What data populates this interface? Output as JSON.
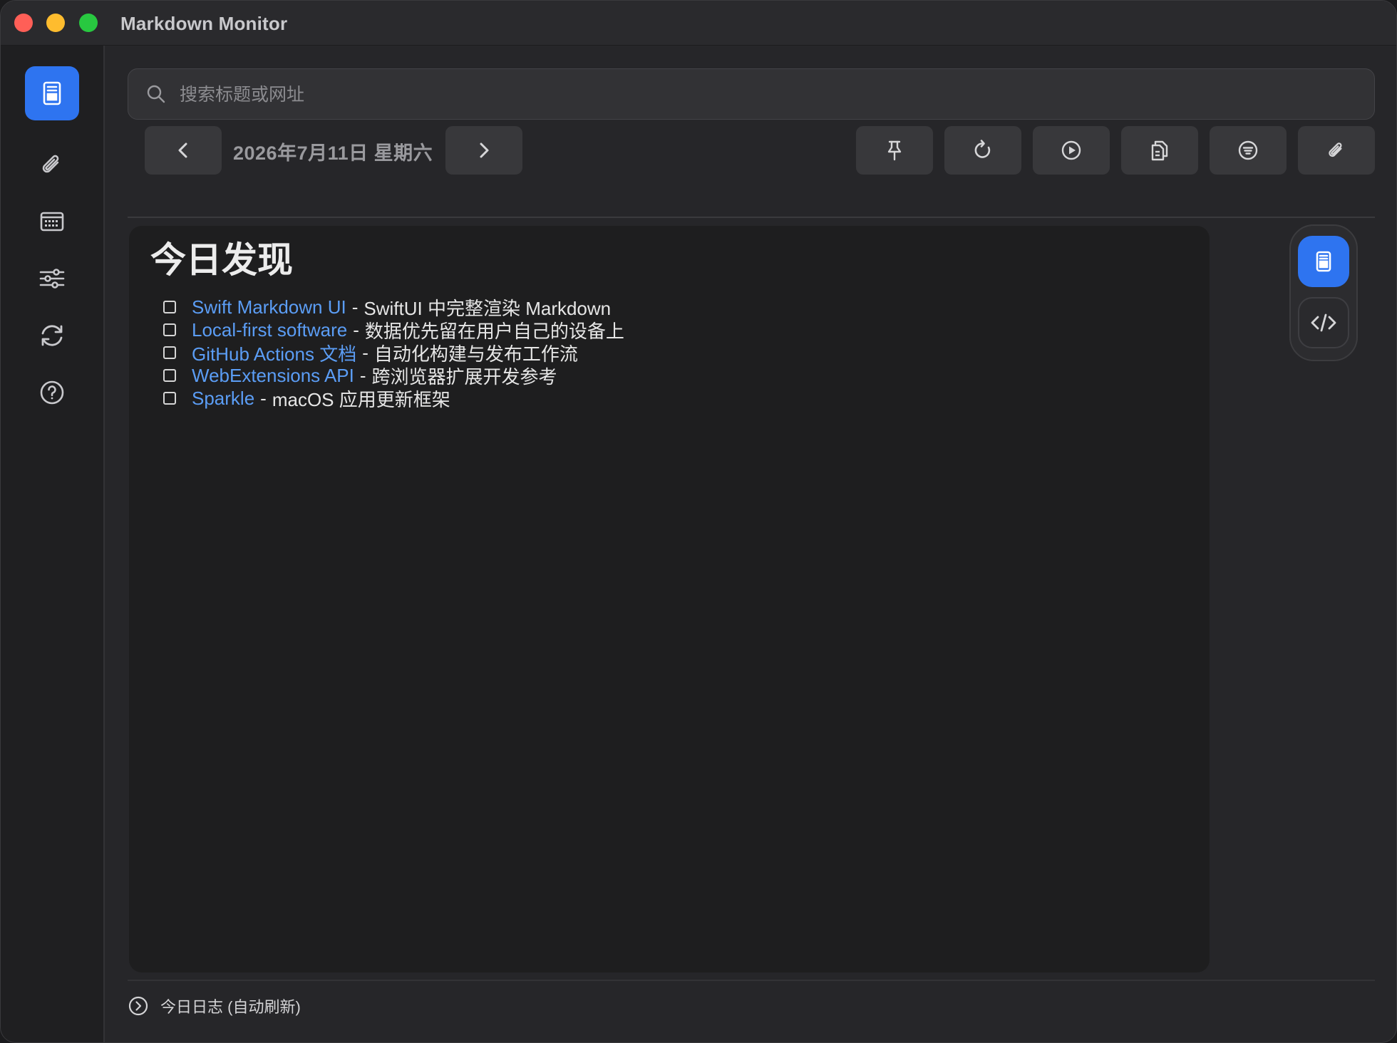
{
  "window": {
    "title": "Markdown Monitor"
  },
  "sidebar": {
    "items": [
      {
        "name": "document",
        "icon": "document-icon",
        "active": true
      },
      {
        "name": "attachments",
        "icon": "paperclip-icon",
        "active": false
      },
      {
        "name": "calendar",
        "icon": "calendar-icon",
        "active": false
      },
      {
        "name": "settings",
        "icon": "sliders-icon",
        "active": false
      },
      {
        "name": "sync",
        "icon": "sync-icon",
        "active": false
      },
      {
        "name": "help",
        "icon": "help-icon",
        "active": false
      }
    ]
  },
  "search": {
    "placeholder": "搜索标题或网址",
    "value": ""
  },
  "date_nav": {
    "date_label": "2026年7月11日 星期六"
  },
  "toolbar": [
    "pin-icon",
    "refresh-icon",
    "play-icon",
    "copy-icon",
    "filter-icon",
    "paperclip-icon"
  ],
  "content": {
    "heading": "今日发现",
    "items": [
      {
        "link": "Swift Markdown UI",
        "desc": "SwiftUI 中完整渲染 Markdown"
      },
      {
        "link": "Local-first software",
        "desc": "数据优先留在用户自己的设备上"
      },
      {
        "link": "GitHub Actions 文档",
        "desc": "自动化构建与发布工作流"
      },
      {
        "link": "WebExtensions API",
        "desc": "跨浏览器扩展开发参考"
      },
      {
        "link": "Sparkle",
        "desc": "macOS 应用更新框架"
      }
    ],
    "separator": "-"
  },
  "view_toggle": {
    "selected": "preview"
  },
  "footer": {
    "status": "今日日志 (自动刷新)"
  },
  "colors": {
    "accent": "#2e74f0",
    "link": "#5b9df5"
  }
}
